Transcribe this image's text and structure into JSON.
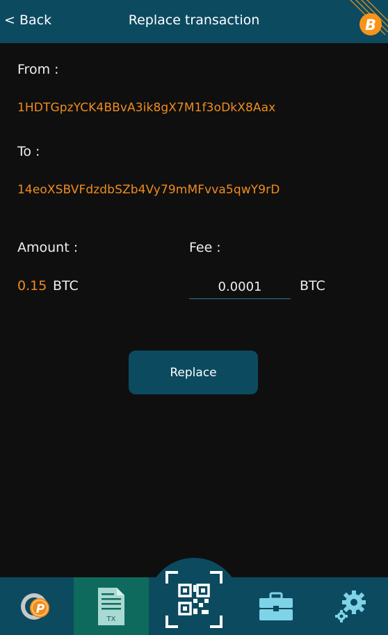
{
  "header": {
    "back_label": "< Back",
    "title": "Replace transaction",
    "brand_icon": "bitcoin-icon"
  },
  "form": {
    "from_label": "From :",
    "from_address": "1HDTGpzYCK4BBvA3ik8gX7M1f3oDkX8Aax",
    "to_label": "To :",
    "to_address": "14eoXSBVFdzdbSZb4Vy79mMFvva5qwY9rD",
    "amount_label": "Amount :",
    "amount_value": "0.15",
    "amount_unit": "BTC",
    "fee_label": "Fee :",
    "fee_value": "0.0001",
    "fee_unit": "BTC",
    "replace_label": "Replace"
  },
  "bottom_nav": {
    "items": [
      {
        "icon": "wallet-p-coin-icon"
      },
      {
        "icon": "transactions-doc-icon",
        "badge": "TX",
        "active": true
      },
      {
        "icon": "qr-scan-icon"
      },
      {
        "icon": "toolbox-icon"
      },
      {
        "icon": "settings-gears-icon"
      }
    ]
  },
  "colors": {
    "bar": "#0c4a60",
    "accent_orange": "#f28c1c",
    "active_tab": "#0e6a5c",
    "background": "#0f0f10"
  }
}
